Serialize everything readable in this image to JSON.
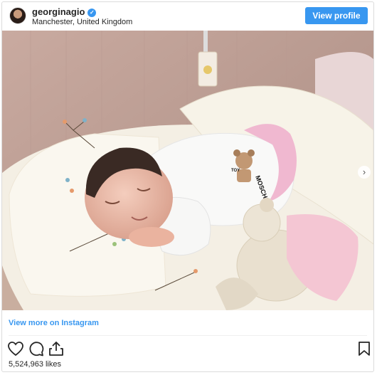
{
  "header": {
    "username": "georginagio",
    "verified_mark": "✓",
    "location": "Manchester, United Kingdom",
    "view_profile_label": "View profile"
  },
  "photo": {
    "next_arrow": "›",
    "moschino_text": "MOSCHINO",
    "toy_text": "TOY"
  },
  "footer": {
    "view_more_label": "View more on Instagram",
    "likes": "5,524,963 likes"
  },
  "icons": [
    "heart-icon",
    "comment-icon",
    "share-icon",
    "bookmark-icon",
    "verified-badge-icon",
    "chevron-right-icon"
  ],
  "colors": {
    "accent": "#3897f0",
    "text": "#262626",
    "border": "#dbdbdb"
  }
}
